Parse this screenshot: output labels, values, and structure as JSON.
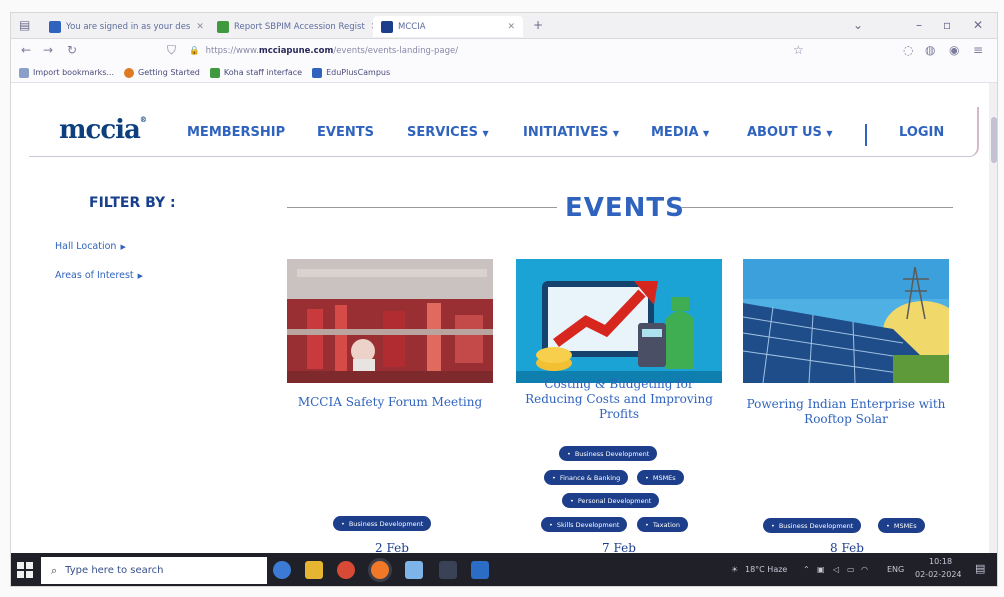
{
  "browser": {
    "tabs": [
      {
        "label": "You are signed in as your des"
      },
      {
        "label": "Report SBPIM Accession Regist"
      },
      {
        "label": "MCCIA"
      }
    ],
    "url_prefix": "https://www.",
    "url_host": "mcciapune.com",
    "url_path": "/events/events-landing-page/",
    "bookmarks": [
      "Import bookmarks...",
      "Getting Started",
      "Koha staff interface",
      "EduPlusCampus"
    ]
  },
  "site": {
    "logo": "mccia",
    "nav": [
      "MEMBERSHIP",
      "EVENTS",
      "SERVICES",
      "INITIATIVES",
      "MEDIA",
      "ABOUT US"
    ],
    "login": "LOGIN"
  },
  "filter": {
    "title": "FILTER BY :",
    "items": [
      "Hall Location",
      "Areas of Interest"
    ]
  },
  "events_heading": "EVENTS",
  "events": [
    {
      "title": "MCCIA Safety Forum Meeting",
      "tags": [
        "Business Development"
      ],
      "date": "2 Feb"
    },
    {
      "title": "Costing & Budgeting for Reducing Costs and Improving Profits",
      "tags": [
        "Business Development",
        "Finance & Banking",
        "MSMEs",
        "Personal Development",
        "Skills Development",
        "Taxation"
      ],
      "date": "7 Feb"
    },
    {
      "title": "Powering Indian Enterprise with Rooftop Solar",
      "tags": [
        "Business Development",
        "MSMEs"
      ],
      "date": "8 Feb"
    }
  ],
  "taskbar": {
    "search_placeholder": "Type here to search",
    "weather": "18°C Haze",
    "lang": "ENG",
    "time": "10:18",
    "date": "02-02-2024"
  }
}
